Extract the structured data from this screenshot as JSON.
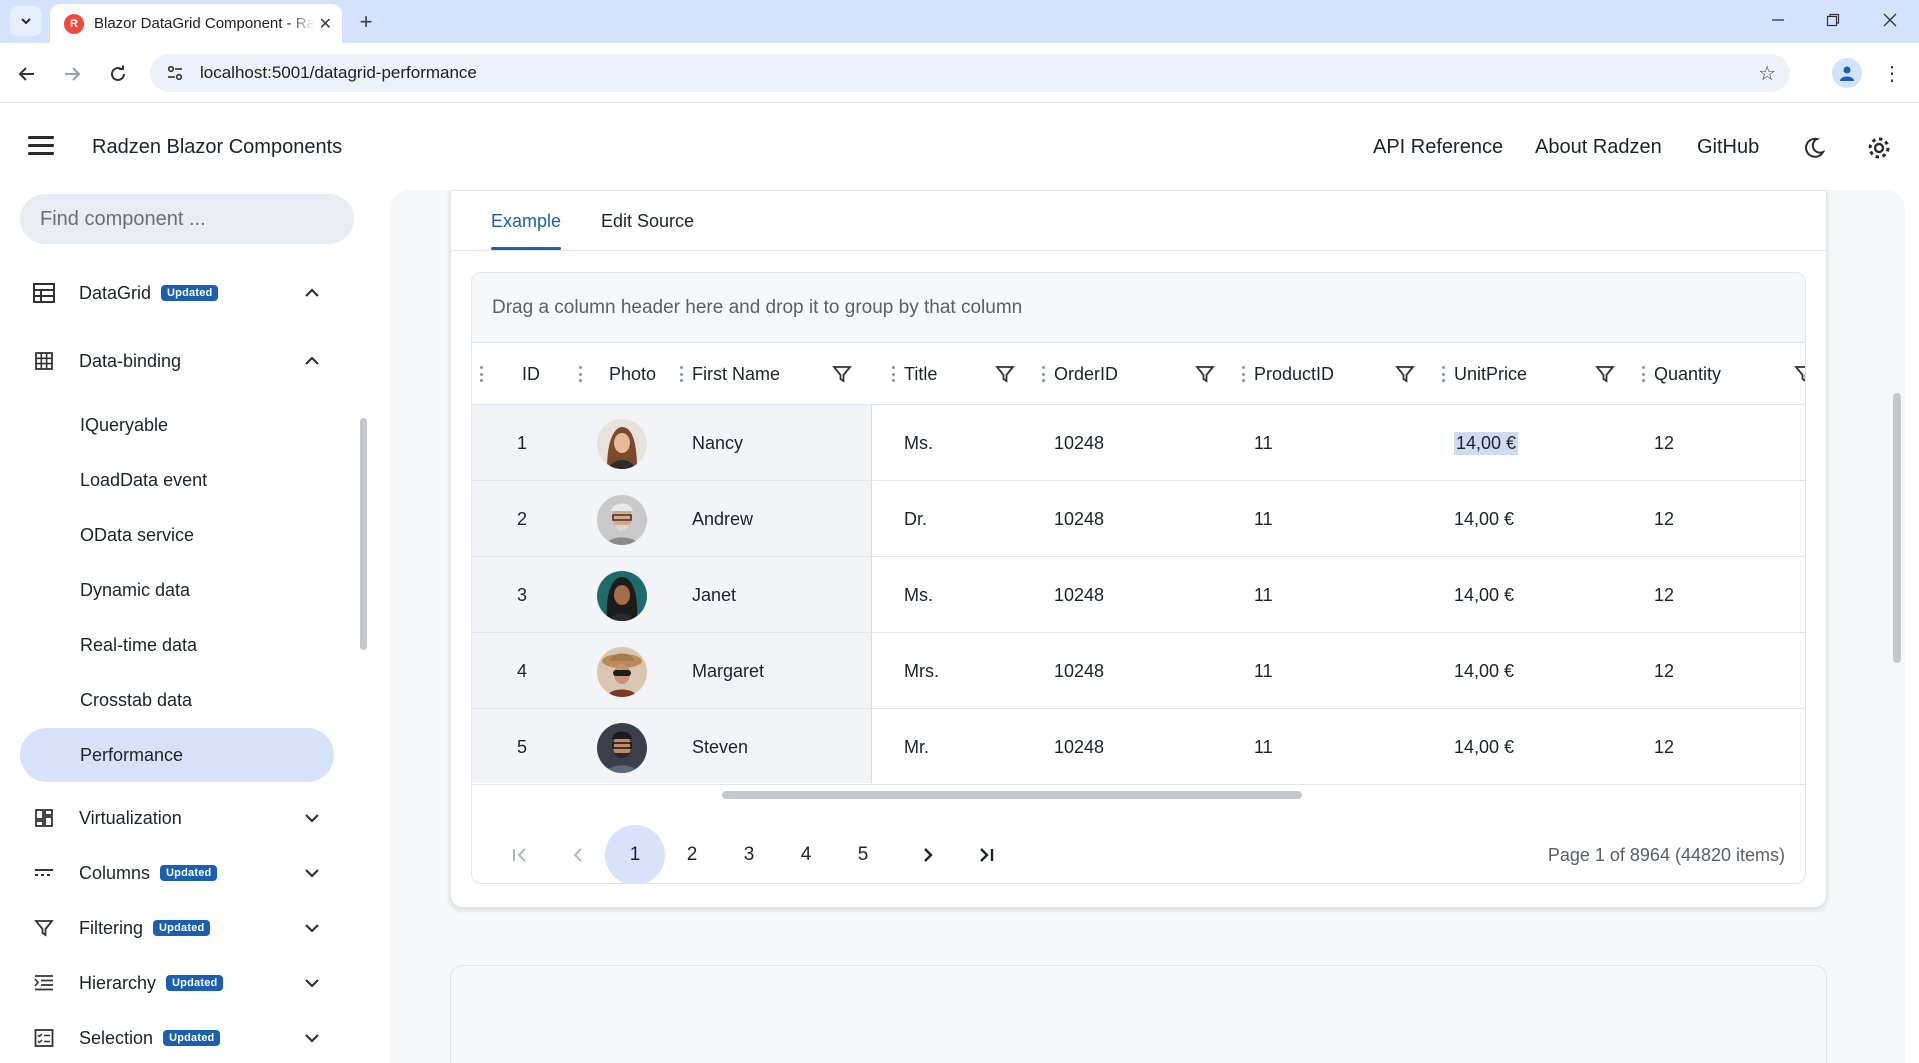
{
  "browser": {
    "tab_title": "Blazor DataGrid Component - Radzen",
    "favicon_letter": "R",
    "url": "localhost:5001/datagrid-performance"
  },
  "header": {
    "app_title": "Radzen Blazor Components",
    "links": [
      "API Reference",
      "About Radzen",
      "GitHub"
    ]
  },
  "sidebar": {
    "search_placeholder": "Find component ...",
    "datagrid": {
      "label": "DataGrid",
      "badge": "Updated"
    },
    "data_binding": {
      "label": "Data-binding"
    },
    "sub_items": [
      "IQueryable",
      "LoadData event",
      "OData service",
      "Dynamic data",
      "Real-time data",
      "Crosstab data",
      "Performance"
    ],
    "active_sub_item": "Performance",
    "sections": [
      {
        "label": "Virtualization",
        "badge": ""
      },
      {
        "label": "Columns",
        "badge": "Updated"
      },
      {
        "label": "Filtering",
        "badge": "Updated"
      },
      {
        "label": "Hierarchy",
        "badge": "Updated"
      },
      {
        "label": "Selection",
        "badge": "Updated"
      }
    ]
  },
  "example": {
    "tabs": [
      "Example",
      "Edit Source"
    ],
    "active_tab": "Example",
    "group_panel_text": "Drag a column header here and drop it to group by that column",
    "columns": [
      "ID",
      "Photo",
      "First Name",
      "Title",
      "OrderID",
      "ProductID",
      "UnitPrice",
      "Quantity"
    ],
    "rows": [
      {
        "id": "1",
        "first_name": "Nancy",
        "title": "Ms.",
        "order_id": "10248",
        "product_id": "11",
        "unit_price": "14,00 €",
        "quantity": "12"
      },
      {
        "id": "2",
        "first_name": "Andrew",
        "title": "Dr.",
        "order_id": "10248",
        "product_id": "11",
        "unit_price": "14,00 €",
        "quantity": "12"
      },
      {
        "id": "3",
        "first_name": "Janet",
        "title": "Ms.",
        "order_id": "10248",
        "product_id": "11",
        "unit_price": "14,00 €",
        "quantity": "12"
      },
      {
        "id": "4",
        "first_name": "Margaret",
        "title": "Mrs.",
        "order_id": "10248",
        "product_id": "11",
        "unit_price": "14,00 €",
        "quantity": "12"
      },
      {
        "id": "5",
        "first_name": "Steven",
        "title": "Mr.",
        "order_id": "10248",
        "product_id": "11",
        "unit_price": "14,00 €",
        "quantity": "12"
      }
    ],
    "pager": {
      "pages": [
        "1",
        "2",
        "3",
        "4",
        "5"
      ],
      "current_page": "1",
      "summary": "Page 1 of 8964 (44820 items)"
    }
  },
  "colors": {
    "accent": "#1b5fb3",
    "active_bg": "#d6e3fb",
    "chrome_tabbar": "#d3e3fd"
  }
}
